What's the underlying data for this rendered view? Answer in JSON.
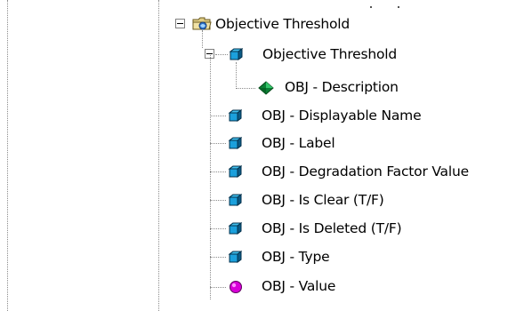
{
  "tree": {
    "root": {
      "label": "Objective Threshold",
      "icon": "folder-icon",
      "expanded": true
    },
    "group": {
      "label": "Objective Threshold",
      "icon": "cube-icon",
      "expanded": true
    },
    "group_child": {
      "label": "OBJ - Description",
      "icon": "diamond-icon"
    },
    "items": [
      {
        "label": "OBJ - Displayable Name",
        "icon": "cube-icon"
      },
      {
        "label": "OBJ - Label",
        "icon": "cube-icon"
      },
      {
        "label": "OBJ - Degradation Factor Value",
        "icon": "cube-icon"
      },
      {
        "label": "OBJ - Is Clear (T/F)",
        "icon": "cube-icon"
      },
      {
        "label": "OBJ - Is Deleted (T/F)",
        "icon": "cube-icon"
      },
      {
        "label": "OBJ - Type",
        "icon": "cube-icon"
      },
      {
        "label": "OBJ - Value",
        "icon": "circle-icon"
      }
    ]
  },
  "colors": {
    "cube": "#0090c8",
    "diamond": "#009a3c",
    "circle": "#d400d4",
    "folder": "#d8c070",
    "tree_lines": "#8c8c8c"
  }
}
